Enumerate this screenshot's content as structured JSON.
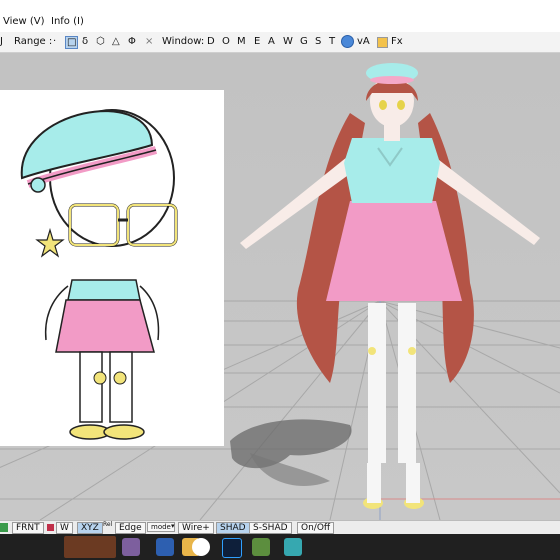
{
  "menubar": {
    "view_label": "View (V)",
    "info_label": "Info (I)"
  },
  "toolbar": {
    "left_fragment": "J",
    "range_label": "Range :",
    "range_dot": "·",
    "range_modes": [
      "□",
      "δ",
      "⬡",
      "△",
      "Φ",
      "×"
    ],
    "window_label": "Window:",
    "window_items": [
      "D",
      "O",
      "M",
      "E",
      "A",
      "W",
      "G",
      "S",
      "T"
    ],
    "globe_icon": "globe-icon",
    "va_label": "vA",
    "fx_label": "Fx"
  },
  "statusbar": {
    "frnt": "FRNT",
    "w": "W",
    "xyz": "XYZ",
    "xyz_sup": "Rel",
    "edge": "Edge",
    "mode": "mode",
    "wire": "Wire+",
    "shad": "SHAD",
    "sshad": "S-SHAD",
    "onoff": "On/Off",
    "active": [
      "XYZ",
      "SHAD"
    ]
  },
  "taskbar": {
    "icons": [
      "app-thumbnail-icon",
      "paint-icon",
      "video-icon",
      "folder-icon",
      "yandex-browser-icon",
      "photoshop-icon",
      "minecraft-icon",
      "pmx-editor-icon"
    ]
  },
  "colors": {
    "viewport": "#c6c6c6",
    "skirt": "#f29bc6",
    "top": "#a7ecea",
    "hair": "#b45446",
    "highlight": "#b7d3ee"
  }
}
